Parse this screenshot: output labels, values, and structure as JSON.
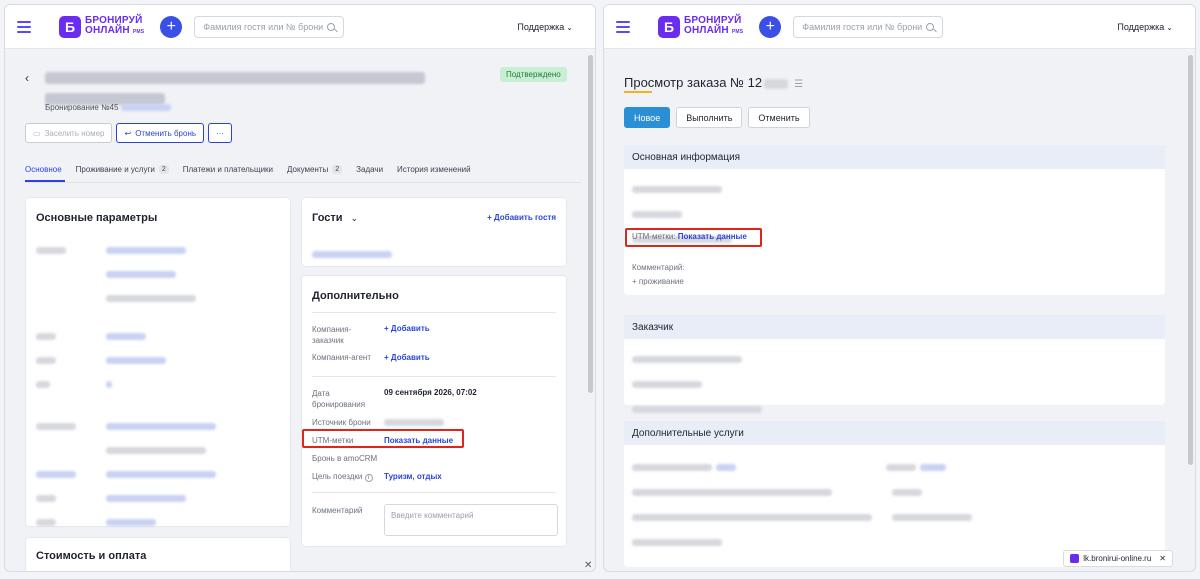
{
  "left": {
    "header": {
      "search_placeholder": "Фамилия гостя или № брони",
      "support": "Поддержка"
    },
    "logo": {
      "line1": "БРОНИРУЙ",
      "line2": "ОНЛАЙН",
      "pms": "PMS"
    },
    "booking": {
      "status": "Подтверждено",
      "number_label": "Бронирование №45"
    },
    "actions": {
      "checkin": "Заселить номер",
      "cancel": "Отменить бронь",
      "more": "···"
    },
    "tabs": [
      {
        "label": "Основное",
        "badge": ""
      },
      {
        "label": "Проживание и услуги",
        "badge": "2"
      },
      {
        "label": "Платежи и плательщики",
        "badge": ""
      },
      {
        "label": "Документы",
        "badge": "2"
      },
      {
        "label": "Задачи",
        "badge": ""
      },
      {
        "label": "История изменений",
        "badge": ""
      }
    ],
    "main_params_title": "Основные параметры",
    "cost_title": "Стоимость и оплата",
    "guests": {
      "title": "Гости",
      "add": "Добавить гостя"
    },
    "additional": {
      "title": "Дополнительно",
      "company_customer": "Компания-заказчик",
      "company_agent": "Компания-агент",
      "add": "Добавить",
      "booking_date_label": "Дата бронирования",
      "booking_date_value": "09 сентября 2026, 07:02",
      "source_label": "Источник брони",
      "utm_label": "UTM-метки",
      "utm_value": "Показать данные",
      "amo_label": "Бронь в amoCRM",
      "trip_label": "Цель поездки",
      "trip_value": "Туризм, отдых",
      "comment_label": "Комментарий",
      "comment_placeholder": "Введите комментарий"
    }
  },
  "right": {
    "header": {
      "search_placeholder": "Фамилия гостя или № брони",
      "support": "Поддержка"
    },
    "title": "Просмотр заказа № 12",
    "buttons": {
      "new": "Новое",
      "execute": "Выполнить",
      "cancel": "Отменить"
    },
    "basic_info_title": "Основная информация",
    "utm_label": "UTM-метки:",
    "utm_value": "Показать данные",
    "comment_label": "Комментарий:",
    "comment_value": "+ проживание",
    "customer_title": "Заказчик",
    "services_title": "Дополнительные услуги",
    "footer_url": "lk.bronirui-online.ru"
  }
}
